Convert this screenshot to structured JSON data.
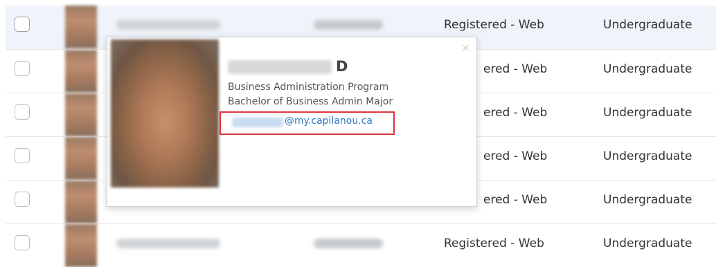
{
  "rows": [
    {
      "status": "Registered - Web",
      "level": "Undergraduate"
    },
    {
      "status": "ered - Web",
      "level": "Undergraduate"
    },
    {
      "status": "ered - Web",
      "level": "Undergraduate"
    },
    {
      "status": "ered - Web",
      "level": "Undergraduate"
    },
    {
      "status": "ered - Web",
      "level": "Undergraduate"
    },
    {
      "status": "Registered - Web",
      "level": "Undergraduate"
    }
  ],
  "popup": {
    "name_initial": "D",
    "program": "Business Administration Program",
    "major": "Bachelor of Business Admin Major",
    "email_domain": "@my.capilanou.ca",
    "close_glyph": "×"
  },
  "colors": {
    "link": "#2f76c3",
    "highlight_box": "#d9363e",
    "selected_row": "#eef4fa"
  }
}
